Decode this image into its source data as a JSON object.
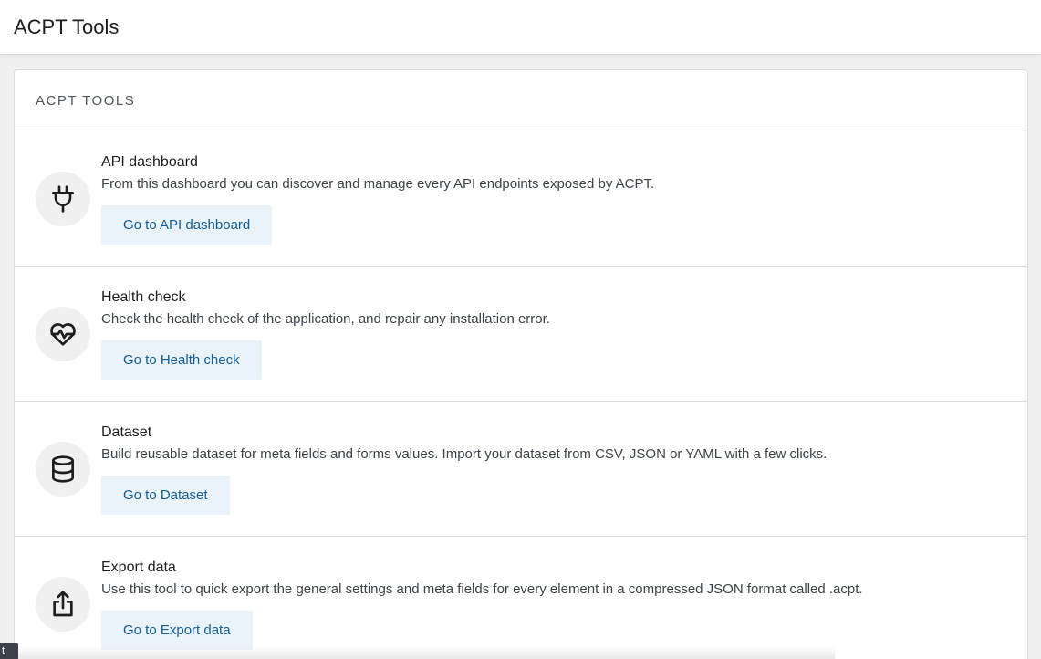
{
  "header": {
    "title": "ACPT Tools"
  },
  "card": {
    "title": "ACPT TOOLS",
    "tools": [
      {
        "name": "API dashboard",
        "description": "From this dashboard you can discover and manage every API endpoints exposed by ACPT.",
        "button": "Go to API dashboard",
        "icon": "plug-icon"
      },
      {
        "name": "Health check",
        "description": "Check the health check of the application, and repair any installation error.",
        "button": "Go to Health check",
        "icon": "heartbeat-icon"
      },
      {
        "name": "Dataset",
        "description": "Build reusable dataset for meta fields and forms values. Import your dataset from CSV, JSON or YAML with a few clicks.",
        "button": "Go to Dataset",
        "icon": "database-icon"
      },
      {
        "name": "Export data",
        "description": "Use this tool to quick export the general settings and meta fields for every element in a compressed JSON format called .acpt.",
        "button": "Go to Export data",
        "icon": "export-icon"
      }
    ]
  },
  "tooltip": {
    "text": "t"
  },
  "colors": {
    "button_bg": "#eaf2fa",
    "button_text": "#135e96",
    "icon_bg": "#f0f0f1"
  }
}
